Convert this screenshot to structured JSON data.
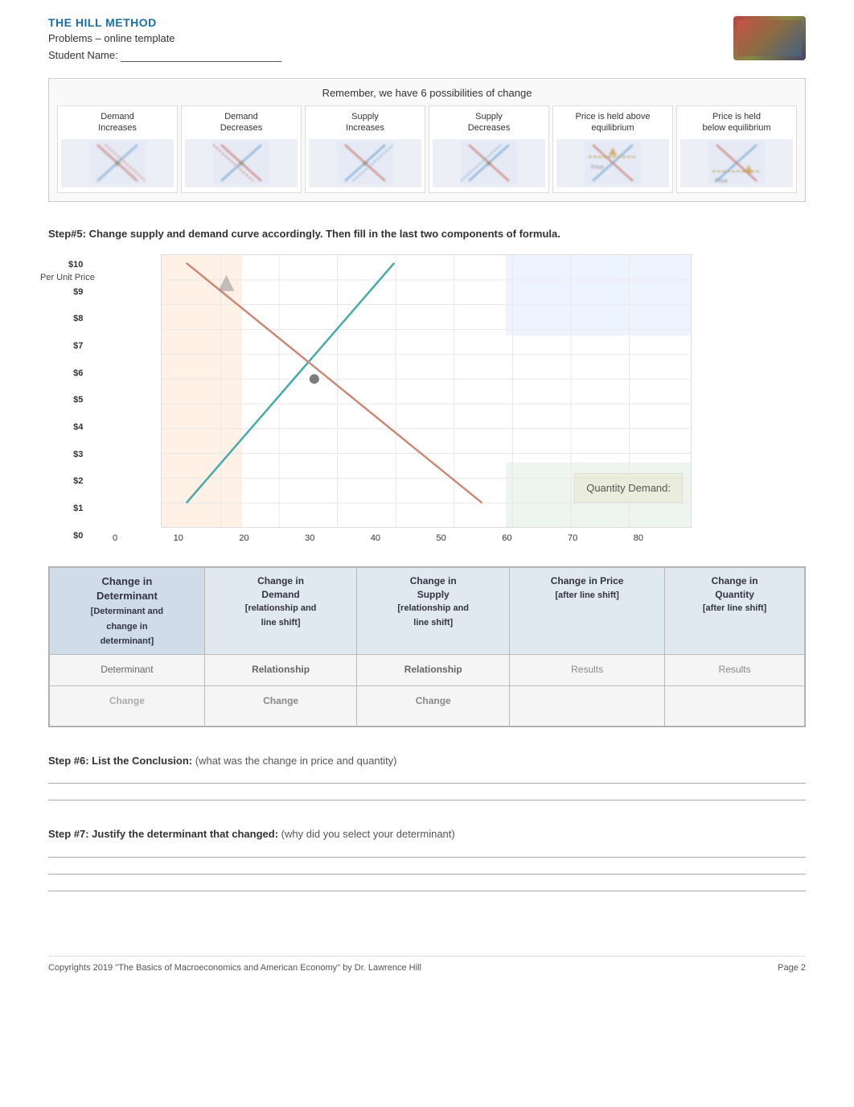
{
  "header": {
    "title": "THE HILL METHOD",
    "subtitle": "Problems – online template",
    "student_label": "Student Name:",
    "student_underline": "____________________________"
  },
  "possibilities": {
    "title": "Remember, we have 6 possibilities of change",
    "items": [
      {
        "label": "Demand\nIncreases"
      },
      {
        "label": "Demand\nDecreases"
      },
      {
        "label": "Supply\nIncreases"
      },
      {
        "label": "Supply\nDecreases"
      },
      {
        "label": "Price is held above\nequilibrium"
      },
      {
        "label": "Price is held\nbelow equilibrium"
      }
    ]
  },
  "step5": {
    "header": "Step#5:   Change supply and demand curve accordingly. Then fill in the last two components of formula.",
    "y_axis_label": "Per Unit Price",
    "y_labels": [
      "$10",
      "$9",
      "$8",
      "$7",
      "$6",
      "$5",
      "$4",
      "$3",
      "$2",
      "$1",
      "$0"
    ],
    "x_labels": [
      "0",
      "10",
      "20",
      "30",
      "40",
      "50",
      "60",
      "70",
      "80"
    ],
    "qty_demand_label": "Quantity Demand:"
  },
  "table": {
    "headers": [
      "Change in\nDeterminant\n[Determinant and\nchange in\ndeterminant]",
      "Change in\nDemand\n[relationship and\nline shift]",
      "Change in\nSupply\n[relationship and\nline shift]",
      "Change in Price\n[after line shift]",
      "Change in\nQuantity\n[after line shift]"
    ],
    "row1_labels": [
      "Determinant",
      "Relationship",
      "Relationship",
      "Results",
      "Results"
    ],
    "row2_labels": [
      "Change",
      "Change",
      "Change",
      "",
      ""
    ]
  },
  "step6": {
    "label": "Step #6: List the Conclusion:",
    "desc": "  (what was the change in price and quantity)"
  },
  "step7": {
    "label": "Step #7: Justify the determinant that changed:",
    "desc": "  (why did you select your determinant)"
  },
  "footer": {
    "copyright": "Copyrights 2019  \"The Basics of Macroeconomics and American Economy\" by Dr. Lawrence Hill",
    "page": "Page  2"
  }
}
